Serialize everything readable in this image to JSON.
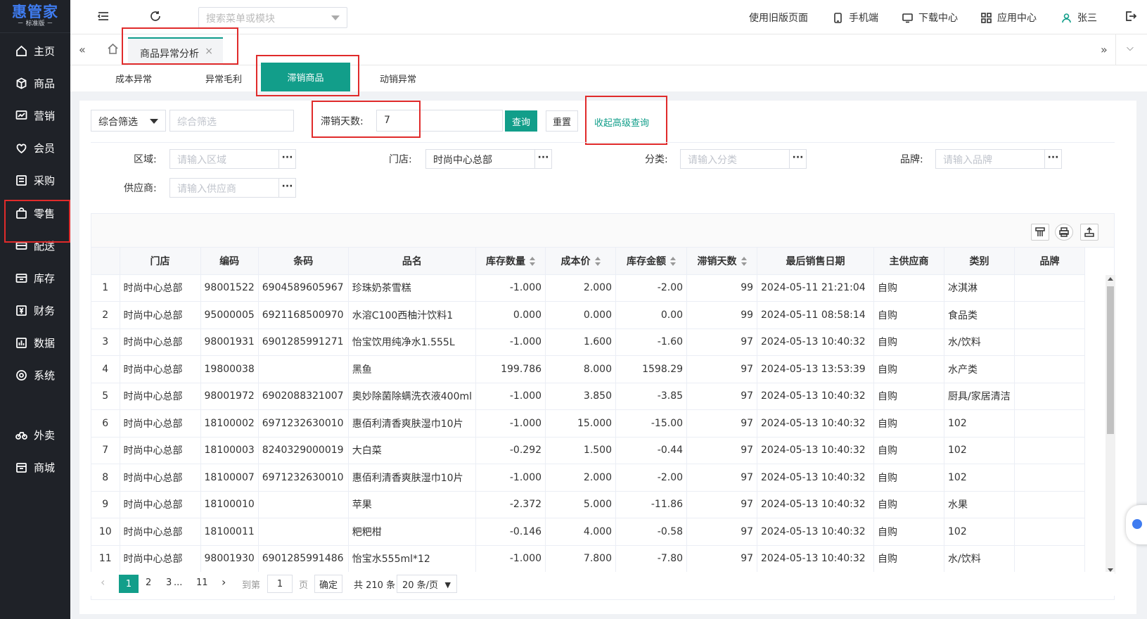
{
  "logo": {
    "name": "惠管家",
    "edition": "－ 标准版 －"
  },
  "sidebar": {
    "items": [
      {
        "label": "主页",
        "icon": "home-icon"
      },
      {
        "label": "商品",
        "icon": "box-icon"
      },
      {
        "label": "营销",
        "icon": "chart-icon"
      },
      {
        "label": "会员",
        "icon": "heart-icon"
      },
      {
        "label": "采购",
        "icon": "purchase-icon"
      },
      {
        "label": "零售",
        "icon": "bag-icon"
      },
      {
        "label": "配送",
        "icon": "truck-icon"
      },
      {
        "label": "库存",
        "icon": "warehouse-icon"
      },
      {
        "label": "财务",
        "icon": "finance-icon"
      },
      {
        "label": "数据",
        "icon": "data-icon"
      },
      {
        "label": "系统",
        "icon": "settings-icon"
      },
      {
        "label": "外卖",
        "icon": "bike-icon"
      },
      {
        "label": "商城",
        "icon": "shop-icon"
      }
    ]
  },
  "header": {
    "search_placeholder": "搜索菜单或模块",
    "old_version": "使用旧版页面",
    "mobile": "手机端",
    "download_center": "下载中心",
    "app_center": "应用中心",
    "user": "张三"
  },
  "page_tab": {
    "label": "商品异常分析",
    "close": "×"
  },
  "subtabs": [
    "成本异常",
    "异常毛利",
    "滞销商品",
    "动销异常"
  ],
  "filters": {
    "combo_select": "综合筛选",
    "combo_placeholder": "综合筛选",
    "stale_days_label": "滞销天数:",
    "stale_days_value": "7",
    "query_button": "查询",
    "reset_button": "重置",
    "collapse_link": "收起高级查询",
    "region_label": "区域:",
    "region_placeholder": "请输入区域",
    "store_label": "门店:",
    "store_value": "时尚中心总部",
    "category_label": "分类:",
    "category_placeholder": "请输入分类",
    "brand_label": "品牌:",
    "brand_placeholder": "请输入品牌",
    "supplier_label": "供应商:",
    "supplier_placeholder": "请输入供应商",
    "more": "···"
  },
  "table": {
    "headers": [
      "",
      "门店",
      "编码",
      "条码",
      "品名",
      "库存数量",
      "成本价",
      "库存金额",
      "滞销天数",
      "最后销售日期",
      "主供应商",
      "类别",
      "品牌"
    ],
    "rows": [
      [
        "1",
        "时尚中心总部",
        "98001522",
        "6904589605967",
        "珍珠奶茶雪糕",
        "-1.000",
        "2.000",
        "-2.00",
        "99",
        "2024-05-11 21:21:04",
        "自购",
        "冰淇淋",
        ""
      ],
      [
        "2",
        "时尚中心总部",
        "95000005",
        "6921168500970",
        "水溶C100西柚汁饮料1",
        "0.000",
        "0.000",
        "0.00",
        "99",
        "2024-05-11 08:58:14",
        "自购",
        "食品类",
        ""
      ],
      [
        "3",
        "时尚中心总部",
        "98001931",
        "6901285991271",
        "怡宝饮用纯净水1.555L",
        "-1.000",
        "1.600",
        "-1.60",
        "97",
        "2024-05-13 10:40:32",
        "自购",
        "水/饮料",
        ""
      ],
      [
        "4",
        "时尚中心总部",
        "19800038",
        "",
        "黑鱼",
        "199.786",
        "8.000",
        "1598.29",
        "97",
        "2024-05-13 13:53:39",
        "自购",
        "水产类",
        ""
      ],
      [
        "5",
        "时尚中心总部",
        "98001972",
        "6902088321007",
        "奥妙除菌除螨洗衣液400ml",
        "-1.000",
        "3.850",
        "-3.85",
        "97",
        "2024-05-13 10:40:32",
        "自购",
        "厨具/家居清洁",
        ""
      ],
      [
        "6",
        "时尚中心总部",
        "18100002",
        "6971232630010",
        "惠佰利清香爽肤湿巾10片",
        "-1.000",
        "15.000",
        "-15.00",
        "97",
        "2024-05-13 10:40:32",
        "自购",
        "102",
        ""
      ],
      [
        "7",
        "时尚中心总部",
        "18100003",
        "8240329000019",
        "大白菜",
        "-0.292",
        "1.500",
        "-0.44",
        "97",
        "2024-05-13 10:40:32",
        "自购",
        "102",
        ""
      ],
      [
        "8",
        "时尚中心总部",
        "18100007",
        "6971232630010",
        "惠佰利清香爽肤湿巾10片",
        "-1.000",
        "2.000",
        "-2.00",
        "97",
        "2024-05-13 10:40:32",
        "自购",
        "102",
        ""
      ],
      [
        "9",
        "时尚中心总部",
        "18100010",
        "",
        "苹果",
        "-2.372",
        "5.000",
        "-11.86",
        "97",
        "2024-05-13 10:40:32",
        "自购",
        "水果",
        ""
      ],
      [
        "10",
        "时尚中心总部",
        "18100011",
        "",
        "粑粑柑",
        "-0.146",
        "4.000",
        "-0.58",
        "97",
        "2024-05-13 10:40:32",
        "自购",
        "102",
        ""
      ],
      [
        "11",
        "时尚中心总部",
        "98001930",
        "6901285991486",
        "怡宝水555ml*12",
        "-1.000",
        "7.800",
        "-7.80",
        "97",
        "2024-05-13 10:40:32",
        "自购",
        "水/饮料",
        ""
      ]
    ]
  },
  "pagination": {
    "prev": "‹",
    "pages": [
      "1",
      "2",
      "3"
    ],
    "ellipsis": "...",
    "last_page": "11",
    "next": "›",
    "goto_label": "到第",
    "goto_value": "1",
    "page_unit": "页",
    "confirm": "确定",
    "total": "共 210 条",
    "page_size": "20 条/页"
  },
  "colors": {
    "accent": "#129e8a",
    "sidebar_bg": "#1f2228",
    "highlight": "#e02b2b"
  }
}
